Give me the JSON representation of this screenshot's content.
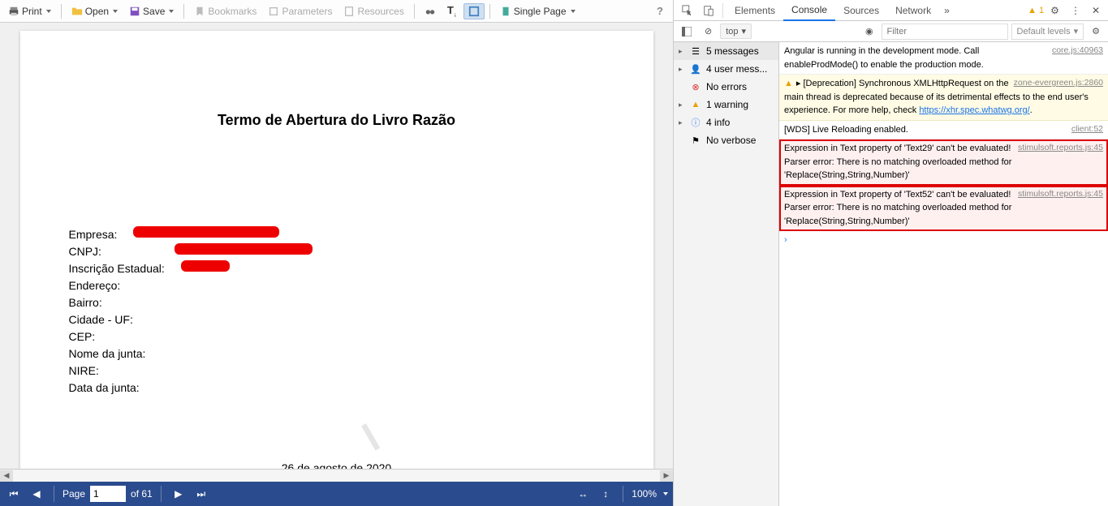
{
  "toolbar": {
    "print": "Print",
    "open": "Open",
    "save": "Save",
    "bookmarks": "Bookmarks",
    "parameters": "Parameters",
    "resources": "Resources",
    "single_page": "Single Page"
  },
  "document": {
    "title": "Termo de Abertura do Livro Razão",
    "fields": {
      "empresa": "Empresa:",
      "cnpj": "CNPJ:",
      "inscricao": "Inscrição Estadual:",
      "endereco": "Endereço:",
      "bairro": "Bairro:",
      "cidade_uf": "Cidade - UF:",
      "cep": "CEP:",
      "nome_junta": "Nome da junta:",
      "nire": "NIRE:",
      "data_junta": "Data da junta:"
    },
    "date": "26 de agosto de 2020"
  },
  "pager": {
    "page_label": "Page",
    "current": "1",
    "of_label": "of 61",
    "zoom": "100%"
  },
  "devtools": {
    "tabs": {
      "elements": "Elements",
      "console": "Console",
      "sources": "Sources",
      "network": "Network"
    },
    "warning_count": "1",
    "filter": {
      "context": "top",
      "placeholder": "Filter",
      "levels": "Default levels"
    },
    "sidebar": {
      "messages": "5 messages",
      "user_messages": "4 user mess...",
      "no_errors": "No errors",
      "warning": "1 warning",
      "info": "4 info",
      "no_verbose": "No verbose"
    },
    "logs": [
      {
        "type": "info",
        "text": "Angular is running in the development mode. Call enableProdMode() to enable the production mode.",
        "source": "core.js:40963"
      },
      {
        "type": "warn",
        "prefix": "▸ [Deprecation] ",
        "text": "Synchronous XMLHttpRequest on the main thread is deprecated because of its detrimental effects to the end user's experience. For more help, check ",
        "link": "https://xhr.spec.whatwg.org/",
        "suffix": ".",
        "source": "zone-evergreen.js:2860"
      },
      {
        "type": "info",
        "text": "[WDS] Live Reloading enabled.",
        "source": "client:52"
      },
      {
        "type": "err",
        "text": "Expression in Text property of 'Text29' can't be evaluated! Parser error: There is no matching overloaded method for 'Replace(String,String,Number)'",
        "source": "stimulsoft.reports.js:45"
      },
      {
        "type": "err",
        "text": "Expression in Text property of 'Text52' can't be evaluated! Parser error: There is no matching overloaded method for 'Replace(String,String,Number)'",
        "source": "stimulsoft.reports.js:45"
      }
    ]
  }
}
